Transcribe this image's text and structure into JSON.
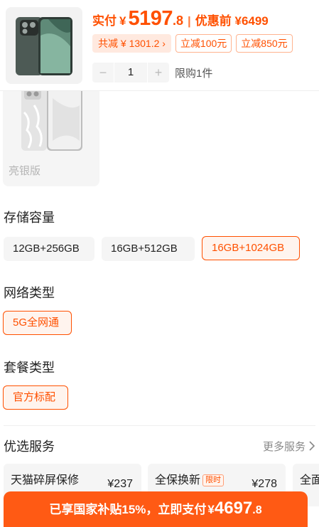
{
  "header": {
    "price_label": "实付",
    "currency": "¥",
    "price_int": "5197",
    "price_dec": ".8",
    "separator": "|",
    "orig_price": "优惠前 ¥6499",
    "total_discount": "共减 ¥ 1301.2 ›",
    "promo_tags": [
      "立减100元",
      "立减850元"
    ],
    "quantity": "1",
    "minus": "−",
    "plus": "+",
    "limit": "限购1件"
  },
  "variant": {
    "name": "亮银版"
  },
  "storage": {
    "title": "存储容量",
    "options": [
      "12GB+256GB",
      "16GB+512GB",
      "16GB+1024GB"
    ]
  },
  "network": {
    "title": "网络类型",
    "options": [
      "5G全网通"
    ]
  },
  "package": {
    "title": "套餐类型",
    "options": [
      "官方标配"
    ]
  },
  "services": {
    "title": "优选服务",
    "more": "更多服务",
    "items": [
      {
        "name": "天猫碎屏保修",
        "price": "¥237"
      },
      {
        "name": "全保换新",
        "badge": "限时",
        "price": "¥278"
      },
      {
        "name": "全面"
      }
    ]
  },
  "pay_bar": {
    "text": "已享国家补贴15%，立即支付",
    "currency": "¥",
    "amount_int": "4697",
    "amount_dec": ".8"
  },
  "colors": {
    "accent": "#ff5000",
    "pay_bar": "#ff5a14",
    "chip_bg": "#f5f5f5"
  }
}
